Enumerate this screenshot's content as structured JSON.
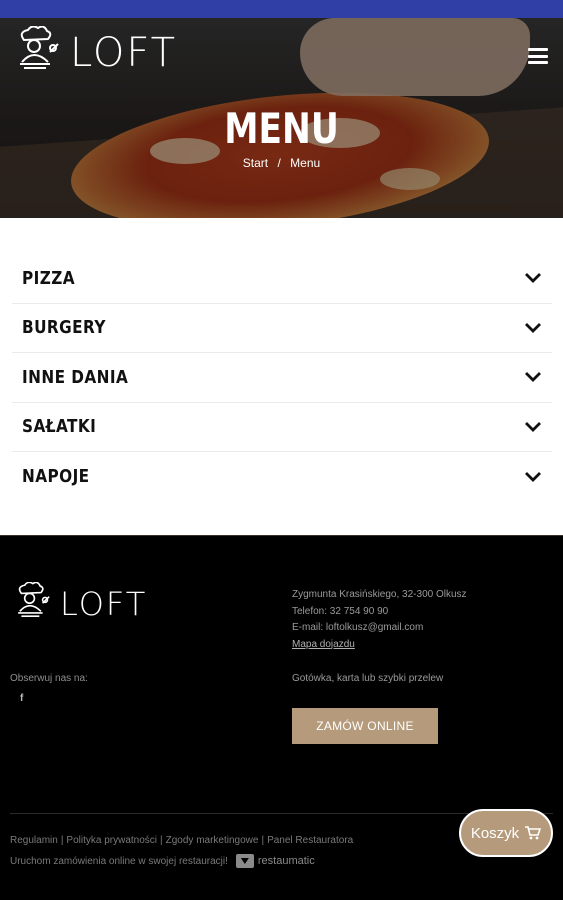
{
  "brand": {
    "name": "LOFT",
    "accent": "#b59a7c",
    "topbar": "#2f3fa5"
  },
  "header": {
    "title": "MENU",
    "breadcrumb": {
      "home": "Start",
      "separator": "/",
      "current": "Menu"
    },
    "menu_icon": "hamburger-icon"
  },
  "categories": [
    {
      "label": "PIZZA"
    },
    {
      "label": "BURGERY"
    },
    {
      "label": "INNE DANIA"
    },
    {
      "label": "SAŁATKI"
    },
    {
      "label": "NAPOJE"
    }
  ],
  "footer": {
    "follow_label": "Obserwuj nas na:",
    "social": {
      "facebook": "f"
    },
    "address": "Zygmunta Krasińskiego, 32-300 Olkusz",
    "phone": "Telefon: 32 754 90 90",
    "email": "E-mail: loftolkusz@gmail.com",
    "map_link": "Mapa dojazdu",
    "payment": "Gotówka, karta lub szybki przelew",
    "order_button": "ZAMÓW ONLINE",
    "legal_links": [
      "Regulamin",
      "Polityka prywatności",
      "Zgody marketingowe",
      "Panel Restauratora"
    ],
    "legal_separator": "|",
    "powered_text": "Uruchom zamówienia online w swojej restauracji!",
    "powered_brand": "restaumatic"
  },
  "cart": {
    "label": "Koszyk",
    "icon": "cart-icon"
  }
}
